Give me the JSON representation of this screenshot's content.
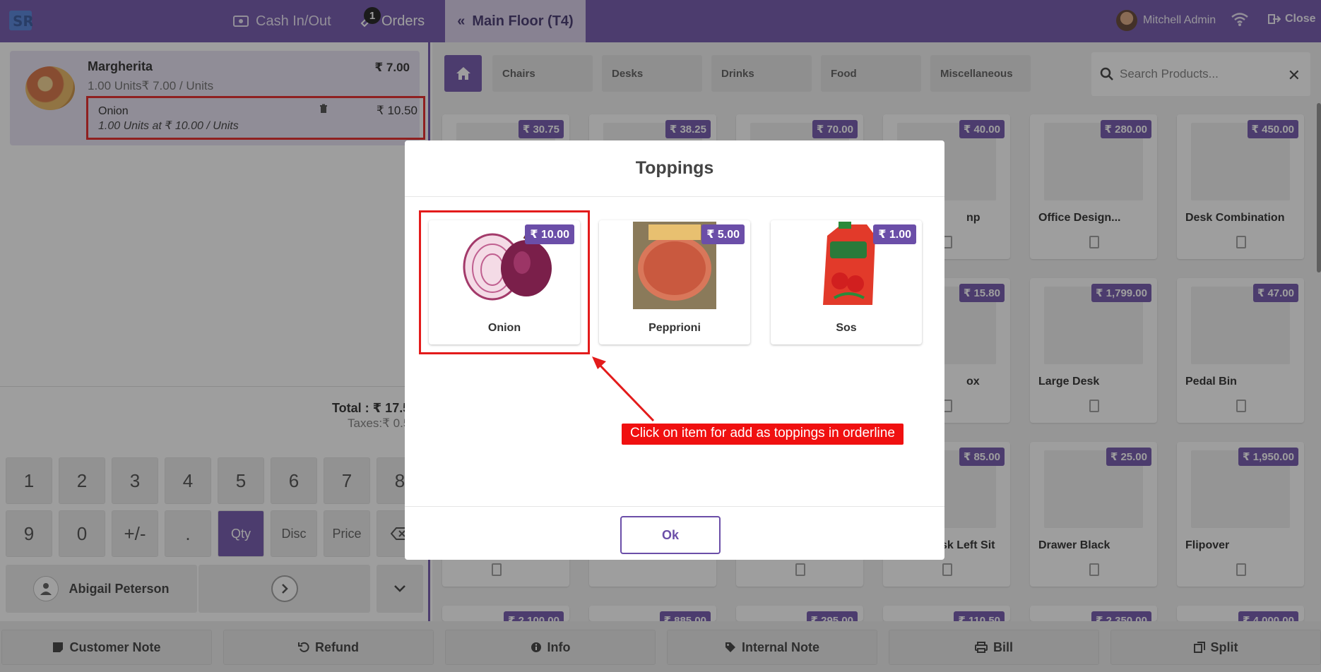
{
  "topbar": {
    "cash_label": "Cash In/Out",
    "orders_label": "Orders",
    "orders_badge": "1",
    "floor_label": "Main Floor (T4)",
    "user_name": "Mitchell Admin",
    "close_label": "Close"
  },
  "order": {
    "line_name": "Margherita",
    "line_price": "₹ 7.00",
    "line_qty": "1.00 Units₹ 7.00 / Units",
    "topping_name": "Onion",
    "topping_detail": "1.00 Units at ₹ 10.00 / Units",
    "topping_price": "₹ 10.50",
    "total": "Total : ₹ 17.5",
    "taxes": "Taxes:₹ 0.5"
  },
  "numpad": {
    "keys": [
      "1",
      "2",
      "3",
      "4",
      "5",
      "6",
      "7",
      "8",
      "9",
      "0",
      "+/-",
      ".",
      "Qty",
      "Disc",
      "Price"
    ],
    "customer": "Abigail Peterson"
  },
  "categories": [
    "Chairs",
    "Desks",
    "Drinks",
    "Food",
    "Miscellaneous"
  ],
  "search": {
    "placeholder": "Search Products..."
  },
  "products": {
    "row1_prices": [
      "₹ 30.75",
      "₹ 38.25",
      "₹ 70.00",
      "₹ 40.00",
      "₹ 280.00",
      "₹ 450.00"
    ],
    "row1_names": [
      "",
      "",
      "",
      "np",
      "Office Design...",
      "Desk Combination"
    ],
    "row2_prices": [
      "",
      "",
      "",
      "₹ 15.80",
      "₹ 1,799.00",
      "₹ 47.00"
    ],
    "row2_names": [
      "",
      "",
      "",
      "ox",
      "Large Desk",
      "Pedal Bin"
    ],
    "row3_prices": [
      "",
      "",
      "",
      "₹ 85.00",
      "₹ 25.00",
      "₹ 1,950.00"
    ],
    "row3_names": [
      "",
      "",
      "",
      "sk Left Sit",
      "Drawer Black",
      "Flipover"
    ],
    "row4_prices": [
      "₹ 2,100.00",
      "₹ 885.00",
      "₹ 295.00",
      "₹ 110.50",
      "₹ 2,350.00",
      "₹ 4,000.00"
    ]
  },
  "bottom": {
    "customer_note": "Customer Note",
    "refund": "Refund",
    "info": "Info",
    "internal_note": "Internal Note",
    "bill": "Bill",
    "split": "Split"
  },
  "modal": {
    "title": "Toppings",
    "items": [
      {
        "name": "Onion",
        "price": "₹ 10.00"
      },
      {
        "name": "Pepprioni",
        "price": "₹ 5.00"
      },
      {
        "name": "Sos",
        "price": "₹ 1.00"
      }
    ],
    "ok_label": "Ok"
  },
  "annotation": "Click on item for add as toppings in orderline",
  "colors": {
    "brand": "#6b4ea8",
    "annotation": "#e31b1b"
  }
}
